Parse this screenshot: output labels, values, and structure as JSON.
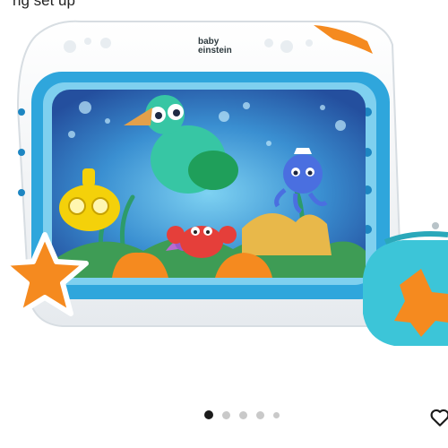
{
  "caption_fragment": "ng set up",
  "product": {
    "brand_line1": "baby",
    "brand_line2": "einstein"
  },
  "carousel": {
    "total_slides": 5,
    "active_index": 0
  },
  "icons": {
    "favorite": "heart-outline-icon"
  },
  "colors": {
    "case_white": "#f4f6f7",
    "frame_blue": "#2fa6dc",
    "water": "#3a8fd1",
    "star_orange": "#f58a1f",
    "dot_active": "#1b1b1b",
    "dot_inactive": "#c9c9c9"
  }
}
